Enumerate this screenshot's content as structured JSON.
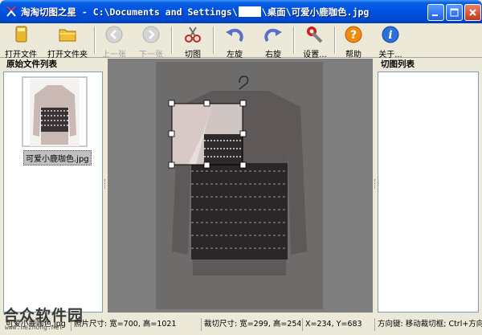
{
  "window": {
    "title_prefix": "淘淘切图之星 - C:\\Documents and Settings\\",
    "title_suffix": "\\桌面\\可爱小鹿咖色.jpg"
  },
  "toolbar": {
    "open_file": "打开文件",
    "open_folder": "打开文件夹",
    "prev": "上一张",
    "next": "下一张",
    "crop": "切图",
    "rotate_left": "左旋",
    "rotate_right": "右旋",
    "settings": "设置...",
    "help": "帮助",
    "about": "关于..."
  },
  "left_panel": {
    "title": "原始文件列表",
    "files": [
      "可爱小鹿咖色.jpg"
    ]
  },
  "right_panel": {
    "title": "切图列表"
  },
  "statusbar": {
    "filename": "可爱小鹿咖色.jpg",
    "image_size_label": "照片尺寸: 宽=700, 高=1021",
    "crop_size_label": "裁切尺寸: 宽=299, 高=254",
    "coords": "X=234, Y=683",
    "hint": "方向键: 移动裁切框; Ctrl+方向键"
  },
  "watermark": {
    "text": "合众软件园",
    "url": "www.hezhong.net"
  }
}
